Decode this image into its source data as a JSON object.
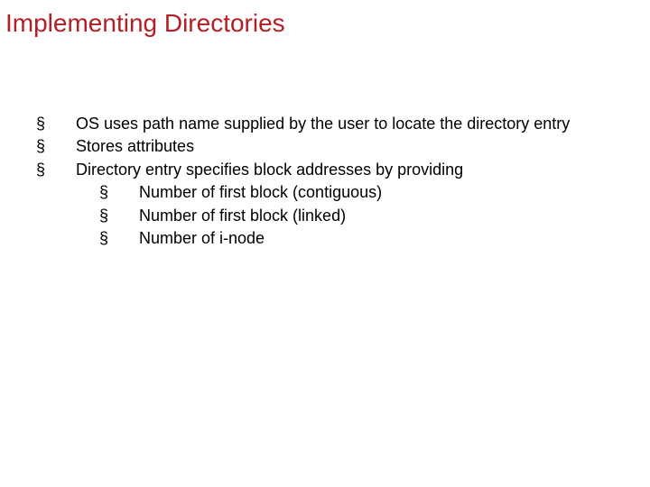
{
  "title": "Implementing Directories",
  "bullets": {
    "level1": [
      "OS uses path name supplied by the user to locate the directory entry",
      "Stores attributes",
      "Directory entry specifies block addresses by providing"
    ],
    "level2": [
      "Number of first block (contiguous)",
      "Number of first block (linked)",
      "Number of i-node"
    ]
  },
  "bullet_char": "§"
}
